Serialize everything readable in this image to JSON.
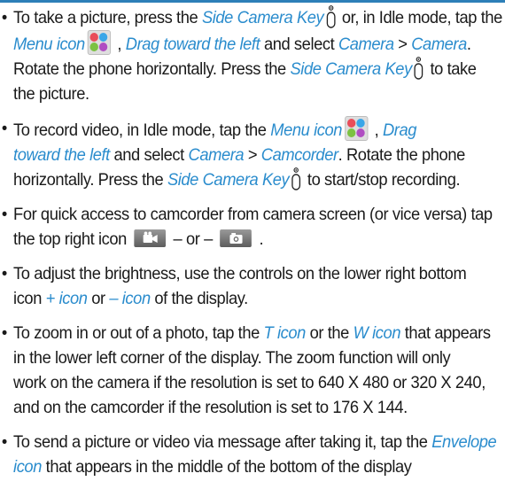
{
  "bullet": "•",
  "items": [
    {
      "b1_1": "To take a picture, press the ",
      "b1_2": "Side Camera Key",
      "b1_3": " or, in Idle mode, tap the",
      "b1_4": "Menu icon",
      "b1_5": " , ",
      "b1_6": "Drag toward the left",
      "b1_7": " and select ",
      "b1_8": "Camera",
      "b1_9": " > ",
      "b1_10": "Camera",
      "b1_11": ".",
      "b1_12": "Rotate the phone horizontally. Press the ",
      "b1_13": "Side Camera Key",
      "b1_14": " to take",
      "b1_15": "the picture."
    }
  ],
  "b2": {
    "t1": "To record video, in Idle mode, tap the ",
    "t2": "Menu icon",
    "t3": " , ",
    "t4": "Drag",
    "t5": "toward the left",
    "t6": " and select ",
    "t7": "Camera",
    "t8": " > ",
    "t9": "Camcorder",
    "t10": ". Rotate the phone",
    "t11": "horizontally. Press the ",
    "t12": "Side Camera Key",
    "t13": " to start/stop recording."
  },
  "b3": {
    "t1": "For quick access to camcorder from camera screen (or vice versa) tap",
    "t2": "the top right icon ",
    "t3": " – or – ",
    "t4": " ."
  },
  "b4": {
    "t1": "To adjust the brightness, use the controls on the lower right bottom",
    "t2": "icon ",
    "t3": "+ icon",
    "t4": " or ",
    "t5": "– icon",
    "t6": " of the display."
  },
  "b5": {
    "t1": "To zoom in or out of a photo, tap the ",
    "t2": "T icon",
    "t3": " or the ",
    "t4": "W icon",
    "t5": " that appears",
    "t6": "in the lower left corner of the display. The zoom function will only",
    "t7": "work on the camera if the resolution is set to 640 X 480 or 320 X 240,",
    "t8": "and on the camcorder if the resolution is set to 176 X 144."
  },
  "b6": {
    "t1": "To send a picture or video via message after taking it, tap the ",
    "t2": "Envelope",
    "t3": "icon",
    "t4": " that appears in the middle of the bottom of the display"
  },
  "colors": {
    "accent": "#2a8ccd",
    "rule": "#2d7fb8"
  },
  "icons": [
    "side-camera-key-icon",
    "menu-icon",
    "camcorder-icon",
    "camera-icon"
  ]
}
